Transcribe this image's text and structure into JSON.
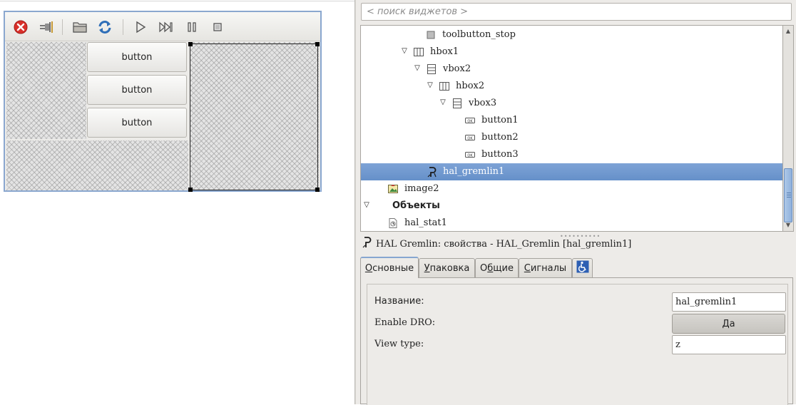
{
  "canvas": {
    "buttons": [
      {
        "label": "button"
      },
      {
        "label": "button"
      },
      {
        "label": "button"
      }
    ],
    "toolbar_icons": [
      "close-icon",
      "plug-icon",
      "folder-icon",
      "reload-icon",
      "play-icon",
      "skip-icon",
      "pause-icon",
      "stop-icon"
    ]
  },
  "search": {
    "placeholder": "< поиск виджетов >"
  },
  "tree": {
    "items": [
      {
        "label": "toolbutton_stop",
        "icon": "toolbutton-icon"
      },
      {
        "label": "hbox1",
        "icon": "hbox-icon",
        "expanded": true
      },
      {
        "label": "vbox2",
        "icon": "vbox-icon",
        "expanded": true
      },
      {
        "label": "hbox2",
        "icon": "hbox-icon",
        "expanded": true
      },
      {
        "label": "vbox3",
        "icon": "vbox-icon",
        "expanded": true
      },
      {
        "label": "button1",
        "icon": "button-widget-icon"
      },
      {
        "label": "button2",
        "icon": "button-widget-icon"
      },
      {
        "label": "button3",
        "icon": "button-widget-icon"
      },
      {
        "label": "hal_gremlin1",
        "icon": "hal-gremlin-icon",
        "selected": true
      },
      {
        "label": "image2",
        "icon": "image-icon"
      },
      {
        "label": "Объекты",
        "icon": "",
        "expanded": true,
        "bold": true
      },
      {
        "label": "hal_stat1",
        "icon": "hal-stat-icon"
      }
    ]
  },
  "properties": {
    "title": "HAL Gremlin: свойства - HAL_Gremlin [hal_gremlin1]",
    "tabs": [
      {
        "label": "Основные",
        "mnemonic": "О",
        "rest": "сновные",
        "active": true
      },
      {
        "label": "Упаковка",
        "mnemonic": "У",
        "rest": "паковка"
      },
      {
        "label": "Общие",
        "mnemonic": "б",
        "prefix": "О",
        "rest": "щие"
      },
      {
        "label": "Сигналы",
        "mnemonic": "С",
        "rest": "игналы"
      }
    ],
    "fields": {
      "name_label": "Название:",
      "name_value": "hal_gremlin1",
      "dro_label": "Enable DRO:",
      "dro_value": "Да",
      "view_label": "View type:",
      "view_value": "z"
    }
  },
  "colors": {
    "selection": "#6f98cf",
    "accent": "#86a6d0",
    "close_red": "#d9302a"
  }
}
